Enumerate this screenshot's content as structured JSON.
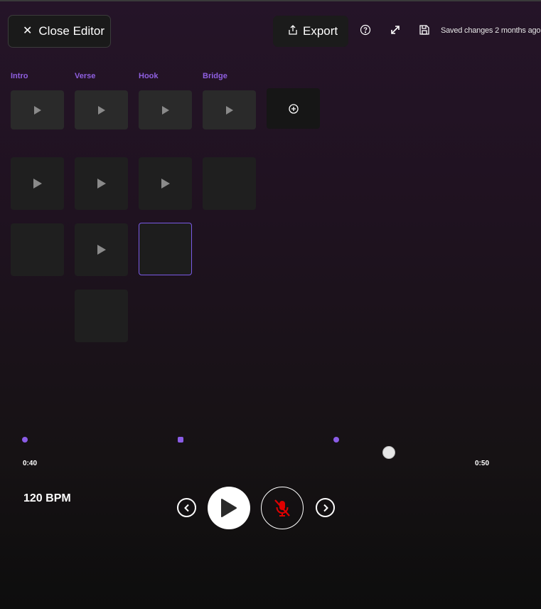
{
  "header": {
    "close_label": "Close Editor",
    "export_label": "Export",
    "saved_status": "Saved changes 2 months ago"
  },
  "columns": [
    {
      "label": "Intro"
    },
    {
      "label": "Verse"
    },
    {
      "label": "Hook"
    },
    {
      "label": "Bridge"
    }
  ],
  "timeline": {
    "start_time": "0:40",
    "end_time": "0:50"
  },
  "transport": {
    "bpm_label": "120 BPM"
  },
  "colors": {
    "accent": "#8a5ce6",
    "label": "#8f5fe0",
    "muted_mic": "#e00000"
  },
  "icons": [
    "close-icon",
    "export-icon",
    "help-icon",
    "expand-icon",
    "save-icon",
    "play-icon",
    "add-icon",
    "previous-icon",
    "next-icon",
    "mic-off-icon"
  ]
}
